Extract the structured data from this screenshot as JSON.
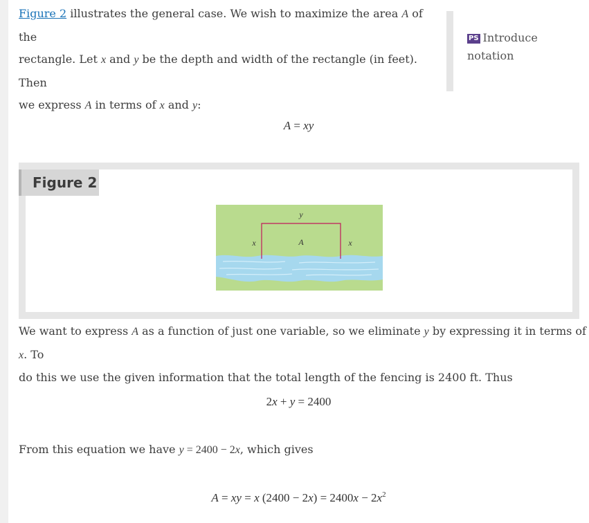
{
  "intro": {
    "link": "Figure 2",
    "t1": " illustrates the general case. We wish to maximize the area ",
    "A": "A",
    "t2": " of the",
    "t3": "rectangle. Let ",
    "x": "x",
    "t4": " and ",
    "y": "y",
    "t5": " be the depth and width of the rectangle (in feet). Then",
    "t6": "we express ",
    "t7": " in terms of ",
    "t8": " and ",
    "t9": ":"
  },
  "side": {
    "badge": "PS",
    "text": "Introduce notation"
  },
  "eq1": {
    "lhs": "A",
    "eq": " = ",
    "rhs": "xy"
  },
  "figure": {
    "label": "Figure 2",
    "y_label": "y",
    "x_left": "x",
    "x_right": "x",
    "area": "A",
    "colors": {
      "land": "#b9db8e",
      "water": "#a6d8ee",
      "fence": "#c2185b"
    }
  },
  "para2": {
    "t1": "We want to express ",
    "A": "A",
    "t2": " as a function of just one variable, so we eliminate ",
    "y": "y",
    "t3": " by expressing it in terms of ",
    "x": "x",
    "t4": ". To",
    "t5": "do this we use the given information that the total length of the fencing is 2400 ft. Thus"
  },
  "eq2": {
    "a": "2",
    "x": "x",
    "plus": " + ",
    "y": "y",
    "rest": " = 2400"
  },
  "para3": {
    "t1": "From this equation we have ",
    "y": "y",
    "mid": " = 2400 − 2",
    "x": "x",
    "t2": ", which gives"
  },
  "eq3": {
    "A": "A",
    "p1": " = ",
    "xy": "xy",
    "p2": " = ",
    "x1": "x",
    "p3": " (2400 − 2",
    "x2": "x",
    "p4": ") = 2400",
    "x3": "x",
    "p5": " − 2",
    "x4": "x",
    "exp": "2"
  }
}
